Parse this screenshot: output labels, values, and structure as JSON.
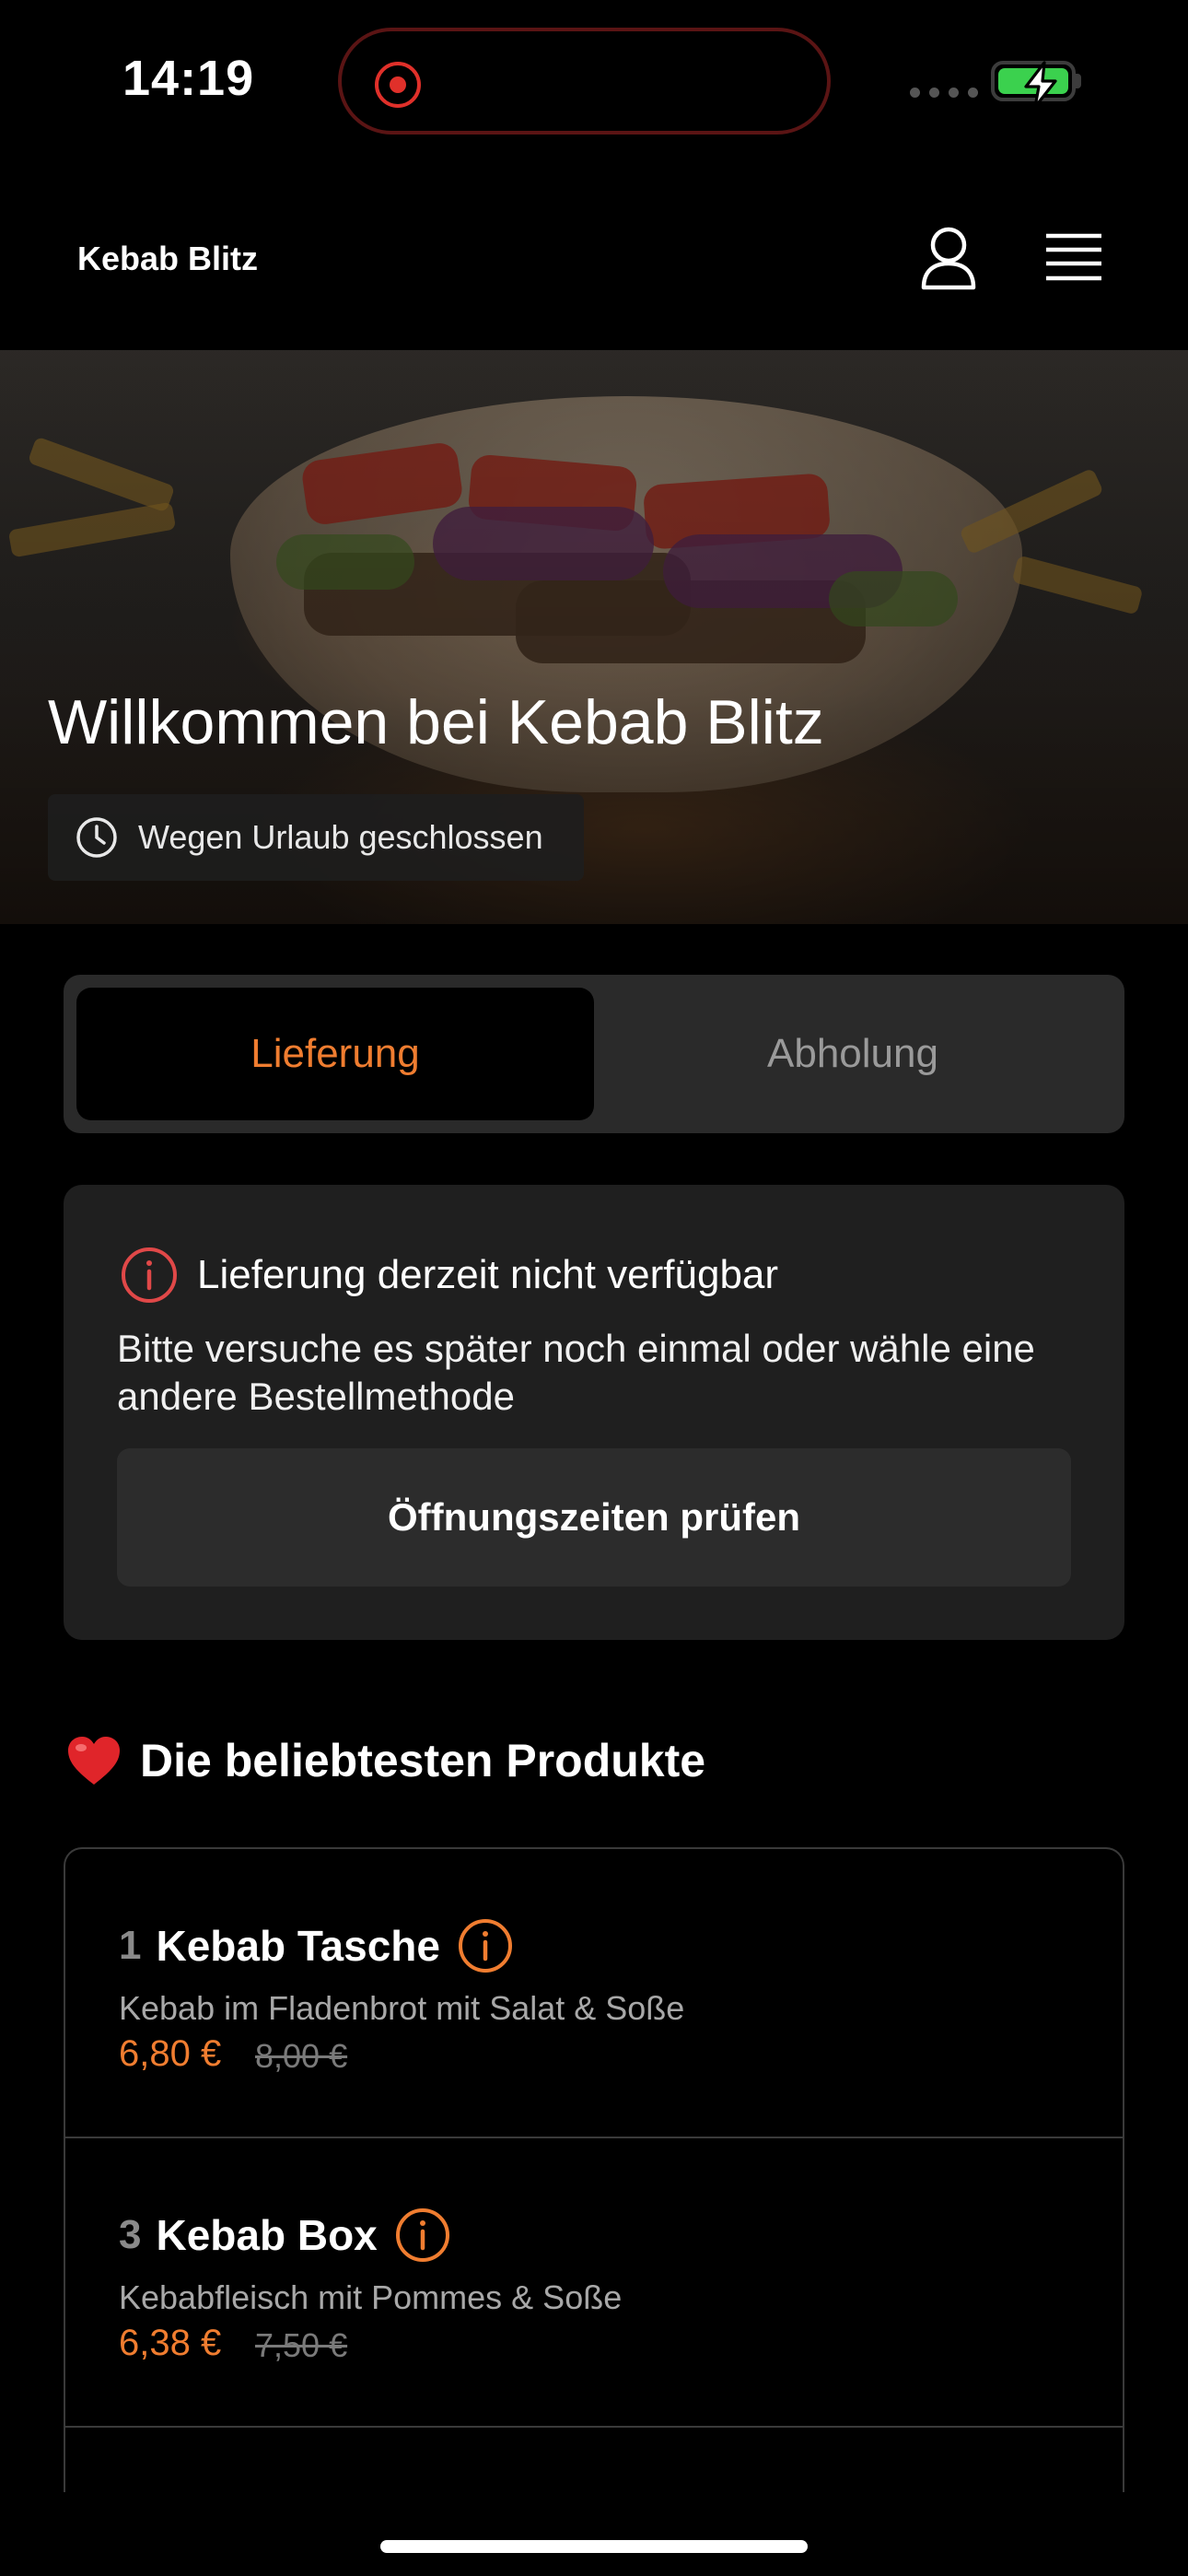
{
  "status_bar": {
    "time": "14:19",
    "icons": [
      "recording-indicator",
      "signal-dots",
      "battery-charging"
    ],
    "battery_color": "#3bd14e"
  },
  "header": {
    "brand": "Kebab Blitz",
    "icons": [
      "user-icon",
      "menu-icon"
    ]
  },
  "hero": {
    "title": "Willkommen bei Kebab Blitz",
    "status_chip": "Wegen Urlaub geschlossen",
    "status_icon": "clock-icon"
  },
  "tabs": {
    "items": [
      {
        "label": "Lieferung",
        "active": true
      },
      {
        "label": "Abholung",
        "active": false
      }
    ],
    "accent": "#f07d30"
  },
  "notice": {
    "icon": "info-icon",
    "title": "Lieferung derzeit nicht verfügbar",
    "text": "Bitte versuche es später noch einmal oder wähle eine andere Bestellmethode",
    "button": "Öffnungszeiten prüfen",
    "icon_color": "#e04848"
  },
  "popular": {
    "title": "Die beliebtesten Produkte",
    "icon": "heart-icon",
    "products": [
      {
        "number": "1",
        "name": "Kebab Tasche",
        "description": "Kebab im Fladenbrot mit Salat & Soße",
        "price": "6,80 €",
        "old_price": "8,00 €"
      },
      {
        "number": "3",
        "name": "Kebab Box",
        "description": "Kebabfleisch mit Pommes & Soße",
        "price": "6,38 €",
        "old_price": "7,50 €"
      }
    ]
  }
}
